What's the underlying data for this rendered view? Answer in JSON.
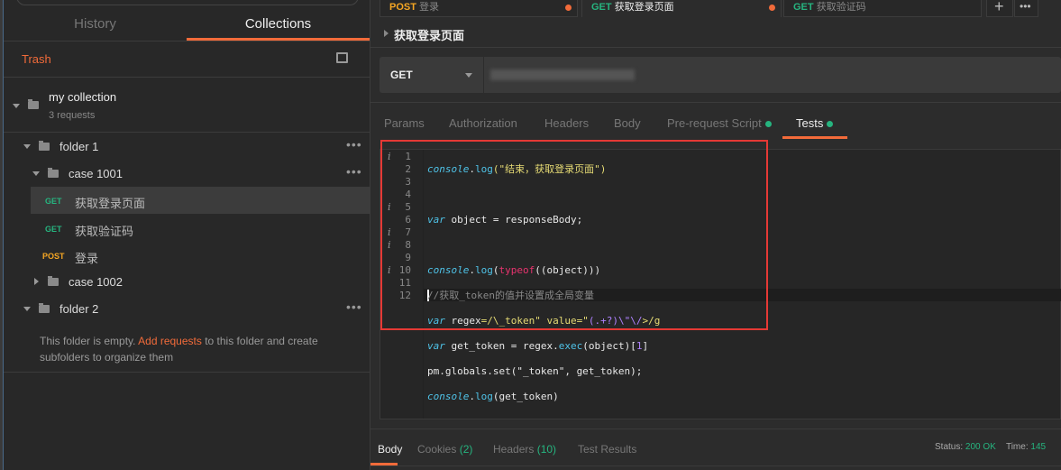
{
  "sidebar": {
    "tabs": [
      {
        "label": "History"
      },
      {
        "label": "Collections"
      }
    ],
    "trash": "Trash",
    "collection": {
      "name": "my collection",
      "count": "3 requests"
    },
    "folder1": "folder 1",
    "case1001": "case 1001",
    "requests": [
      {
        "method": "GET",
        "name": "获取登录页面"
      },
      {
        "method": "GET",
        "name": "获取验证码"
      },
      {
        "method": "POST",
        "name": "登录"
      }
    ],
    "case1002": "case 1002",
    "folder2": "folder 2",
    "empty": {
      "pre": "This folder is empty. ",
      "link": "Add requests",
      "post": " to this folder and create subfolders to organize them"
    }
  },
  "tabs": [
    {
      "method": "POST",
      "name": "登录"
    },
    {
      "method": "GET",
      "name": "获取登录页面"
    },
    {
      "method": "GET",
      "name": "获取验证码"
    }
  ],
  "request": {
    "title": "获取登录页面",
    "method": "GET"
  },
  "req_tabs": [
    "Params",
    "Authorization",
    "Headers",
    "Body",
    "Pre-request Script",
    "Tests"
  ],
  "code_lines": [
    "1",
    "2",
    "3",
    "4",
    "5",
    "6",
    "7",
    "8",
    "9",
    "10",
    "11",
    "12"
  ],
  "code": {
    "l1": [
      "console",
      ".",
      "log",
      "(\"结束，获取登录页面\")"
    ],
    "l3": [
      "var",
      " object = responseBody;"
    ],
    "l5": [
      "console",
      ".",
      "log",
      "(",
      "typeof",
      "((object)))"
    ],
    "l6": "//获取_token的值并设置成全局变量",
    "l7": [
      "var",
      " regex",
      "=/\\_token\" value=\"",
      "(.+?)",
      "\\\"\\/",
      ">/g"
    ],
    "l8": [
      "var",
      " get_token = regex.",
      "exec",
      "(object)[",
      "1",
      "]"
    ],
    "l9": "pm.globals.set(\"_token\", get_token);",
    "l10": [
      "console",
      ".",
      "log",
      "(get_token)"
    ]
  },
  "response": {
    "tabs": [
      "Body",
      "Cookies",
      "Headers",
      "Test Results"
    ],
    "cookies_count": "(2)",
    "headers_count": "(10)",
    "status_label": "Status:",
    "status": "200 OK",
    "time_label": "Time:",
    "time": "145"
  },
  "colors": {
    "accent": "#f26b3a",
    "get": "#26b47f",
    "post": "#f5a623",
    "highlight": "#e53935"
  }
}
